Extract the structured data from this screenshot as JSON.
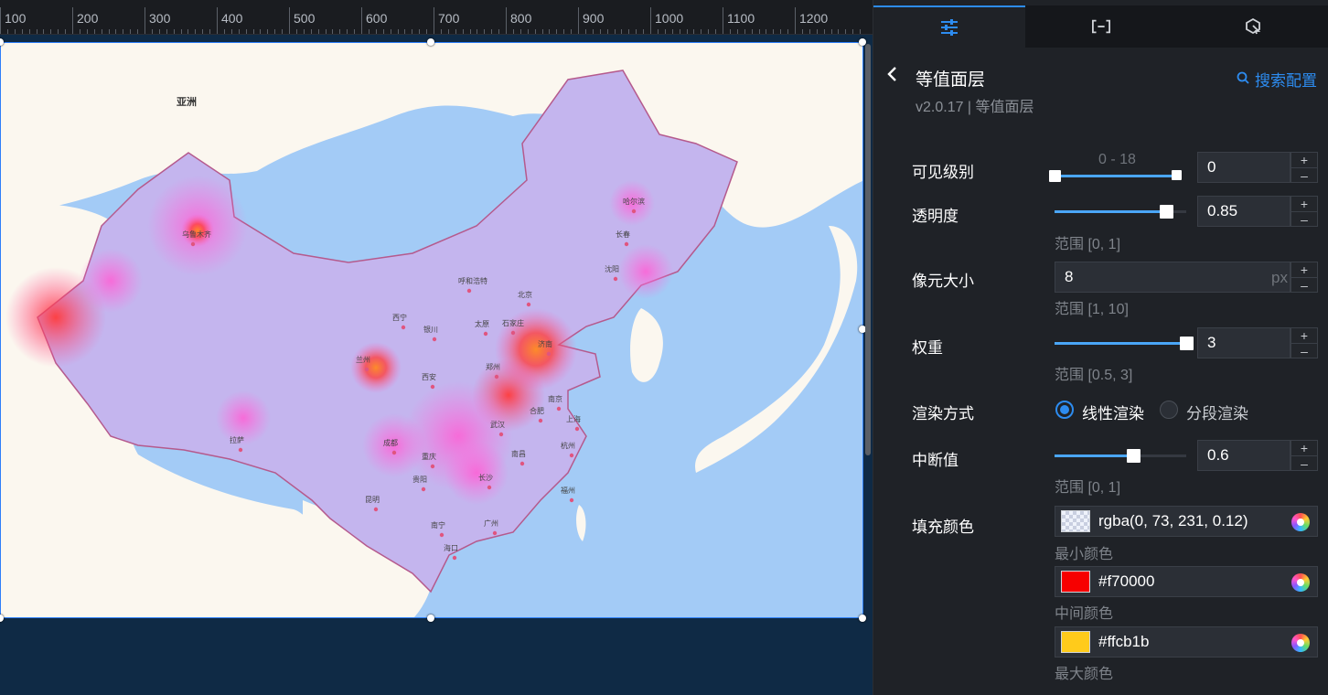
{
  "ruler": {
    "labels": [
      "100",
      "200",
      "300",
      "400",
      "500",
      "600",
      "700",
      "800",
      "900",
      "1000",
      "1100",
      "1200"
    ]
  },
  "map": {
    "asia_label": "亚洲",
    "cities": [
      "乌鲁木齐",
      "哈尔滨",
      "长春",
      "沈阳",
      "呼和浩特",
      "北京",
      "太原",
      "石家庄",
      "西宁",
      "兰州",
      "银川",
      "西安",
      "郑州",
      "济南",
      "拉萨",
      "成都",
      "重庆",
      "武汉",
      "合肥",
      "南京",
      "上海",
      "杭州",
      "长沙",
      "南昌",
      "贵阳",
      "昆明",
      "福州",
      "广州",
      "南宁",
      "海口"
    ]
  },
  "tabs": [
    {
      "name": "style",
      "icon": "sliders-icon"
    },
    {
      "name": "data",
      "icon": "bracket-icon"
    },
    {
      "name": "interaction",
      "icon": "cursor-icon"
    }
  ],
  "panel": {
    "title": "等值面层",
    "version": "v2.0.17 | 等值面层",
    "search_label": "搜索配置",
    "visible_level": {
      "label": "可见级别",
      "range_text": "0 - 18",
      "value": "0",
      "min": 0,
      "max": 18,
      "low": 0,
      "high": 18
    },
    "opacity": {
      "label": "透明度",
      "value": "0.85",
      "hint": "范围 [0, 1]",
      "fraction": 0.85
    },
    "pixel_size": {
      "label": "像元大小",
      "value": "8",
      "unit": "px",
      "hint": "范围 [1, 10]"
    },
    "weight": {
      "label": "权重",
      "value": "3",
      "hint": "范围 [0.5, 3]",
      "fraction": 1.0
    },
    "render_mode": {
      "label": "渲染方式",
      "option_linear": "线性渲染",
      "option_segment": "分段渲染",
      "selected": "线性渲染"
    },
    "mid_break": {
      "label": "中断值",
      "value": "0.6",
      "hint": "范围 [0, 1]",
      "fraction": 0.6
    },
    "fill_color": {
      "label": "填充颜色",
      "min": {
        "value": "rgba(0, 73, 231, 0.12)",
        "caption": "最小颜色"
      },
      "mid": {
        "value": "#f70000",
        "caption": "中间颜色",
        "swatch": "#f70000"
      },
      "max": {
        "value": "#ffcb1b",
        "caption": "最大颜色",
        "swatch": "#ffcb1b"
      }
    }
  }
}
